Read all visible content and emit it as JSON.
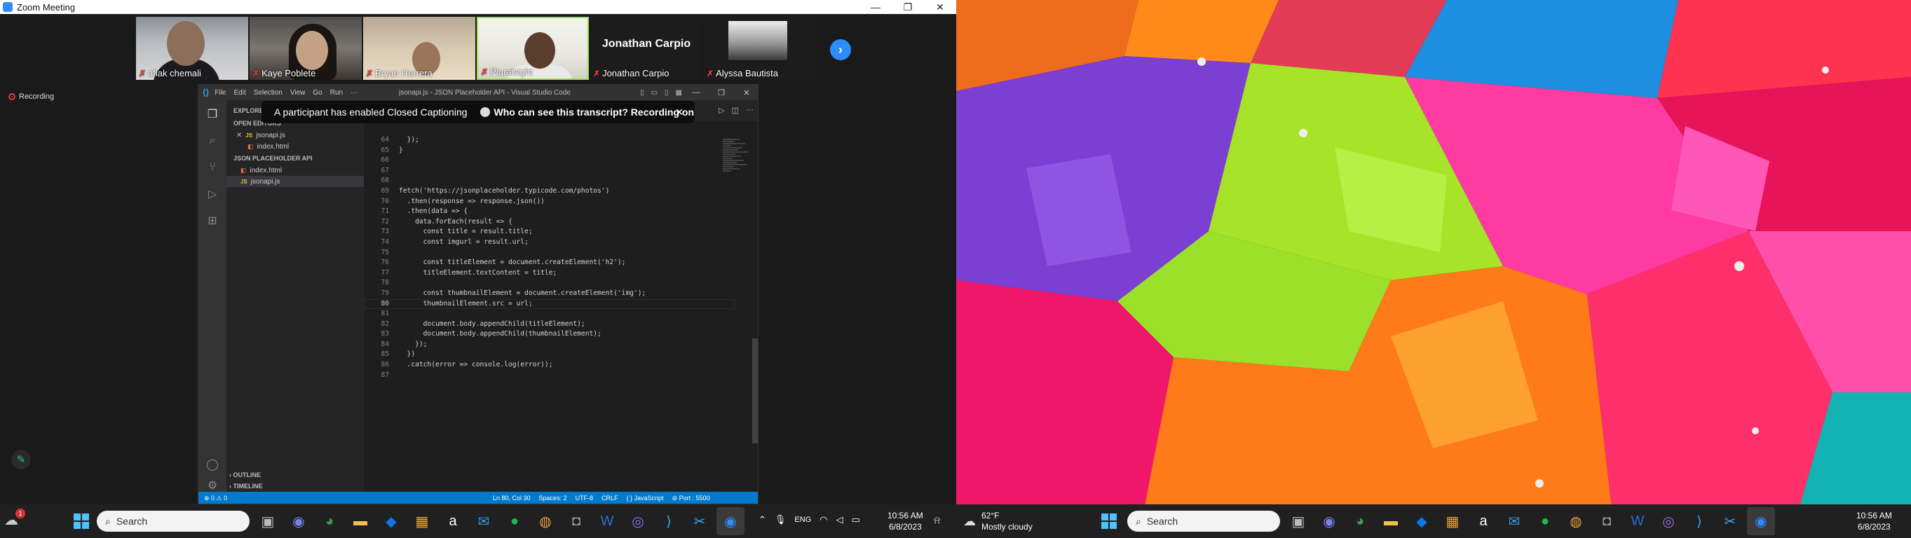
{
  "zoom": {
    "window_title": "Zoom Meeting",
    "window_controls": [
      "—",
      "❐",
      "✕"
    ],
    "participants": [
      {
        "name": "aflak chemali",
        "mic_muted": true
      },
      {
        "name": "Kaye Poblete",
        "mic_muted": true
      },
      {
        "name": "Bryan Herrera",
        "mic_muted": true
      },
      {
        "name": "Pluralsight",
        "mic_muted": true
      },
      {
        "name": "Jonathan Carpio",
        "mic_muted": true,
        "big_label": "Jonathan Carpio"
      },
      {
        "name": "Alyssa Bautista",
        "mic_muted": true
      }
    ],
    "recording_label": "Recording",
    "captions_toast": {
      "message": "A participant has enabled Closed Captioning",
      "link": "Who can see this transcript? Recording on",
      "close": "✕"
    }
  },
  "vscode": {
    "menu": [
      "File",
      "Edit",
      "Selection",
      "View",
      "Go",
      "Run",
      "···"
    ],
    "window_title": "jsonapi.js - JSON Placeholder API - Visual Studio Code",
    "window_controls": [
      "—",
      "❐",
      "✕"
    ],
    "sidebar": {
      "explorer_label": "EXPLORER",
      "open_editors_label": "OPEN EDITORS",
      "open_editors": [
        {
          "name": "jsonapi.js",
          "type": "js"
        },
        {
          "name": "index.html",
          "type": "html"
        }
      ],
      "project_label": "JSON PLACEHOLDER API",
      "project_files": [
        {
          "name": "index.html",
          "type": "html"
        },
        {
          "name": "jsonapi.js",
          "type": "js"
        }
      ],
      "outline_label": "OUTLINE",
      "timeline_label": "TIMELINE"
    },
    "code_lines": [
      {
        "n": "64",
        "t": "  });"
      },
      {
        "n": "65",
        "t": "}"
      },
      {
        "n": "66",
        "t": ""
      },
      {
        "n": "67",
        "t": ""
      },
      {
        "n": "68",
        "t": ""
      },
      {
        "n": "69",
        "t": "fetch('https://jsonplaceholder.typicode.com/photos')"
      },
      {
        "n": "70",
        "t": "  .then(response => response.json())"
      },
      {
        "n": "71",
        "t": "  .then(data => {"
      },
      {
        "n": "72",
        "t": "    data.forEach(result => {"
      },
      {
        "n": "73",
        "t": "      const title = result.title;"
      },
      {
        "n": "74",
        "t": "      const imgurl = result.url;"
      },
      {
        "n": "75",
        "t": ""
      },
      {
        "n": "76",
        "t": "      const titleElement = document.createElement('h2');"
      },
      {
        "n": "77",
        "t": "      titleElement.textContent = title;"
      },
      {
        "n": "78",
        "t": ""
      },
      {
        "n": "79",
        "t": "      const thumbnailElement = document.createElement('img');"
      },
      {
        "n": "80",
        "t": "      thumbnailElement.src = url;"
      },
      {
        "n": "81",
        "t": ""
      },
      {
        "n": "82",
        "t": "      document.body.appendChild(titleElement);"
      },
      {
        "n": "83",
        "t": "      document.body.appendChild(thumbnailElement);"
      },
      {
        "n": "84",
        "t": "    });"
      },
      {
        "n": "85",
        "t": "  })"
      },
      {
        "n": "86",
        "t": "  .catch(error => console.log(error));"
      },
      {
        "n": "87",
        "t": ""
      }
    ],
    "statusbar": {
      "left": "⊗ 0 ⚠ 0",
      "right": [
        "Ln 80, Col 30",
        "Spaces: 2",
        "UTF-8",
        "CRLF",
        "{ } JavaScript",
        "⊘ Port : 5500"
      ]
    }
  },
  "taskbar_left": {
    "search_placeholder": "Search",
    "notification_count": "1",
    "language": "ENG",
    "time": "10:56 AM",
    "date": "6/8/2023"
  },
  "taskbar_right": {
    "weather_temp": "62°F",
    "weather_desc": "Mostly cloudy",
    "search_placeholder": "Search",
    "time": "10:56 AM",
    "date": "6/8/2023"
  },
  "colors": {
    "zoom_blue": "#2d8cff",
    "vscode_status": "#007acc",
    "taskbar": "#202020"
  }
}
